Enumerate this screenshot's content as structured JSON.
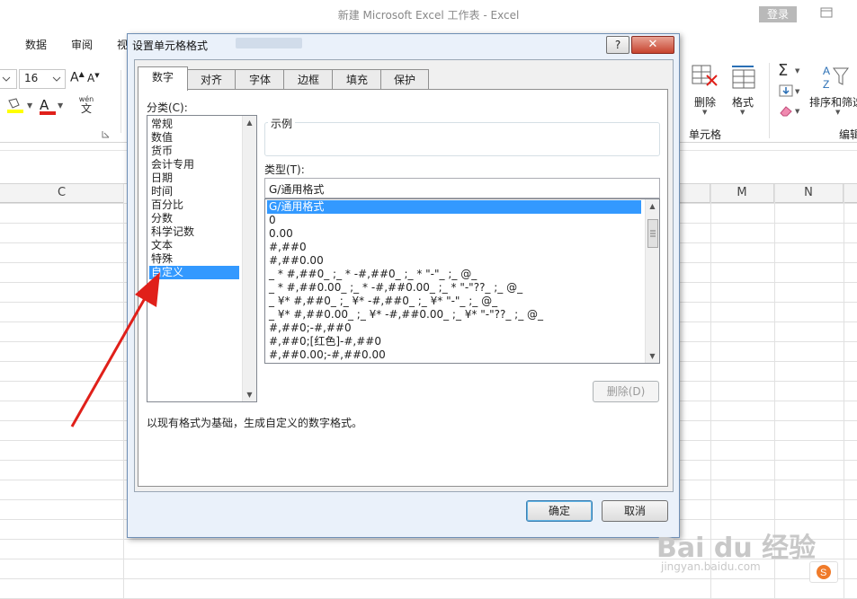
{
  "window": {
    "title": "新建 Microsoft Excel 工作表 - Excel",
    "login_label": "登录"
  },
  "menu": {
    "items": [
      "数据",
      "审阅",
      "视"
    ]
  },
  "ribbon": {
    "font_size": "16",
    "grow_font": "A",
    "shrink_font": "A",
    "font_color_letter": "A",
    "phonetic_label": "wén",
    "phonetic_char": "文",
    "cells_group": {
      "delete_label": "删除",
      "format_label": "格式",
      "group_label": "单元格"
    },
    "edit_group": {
      "sort_filter_label": "排序和筛选",
      "group_label": "编辑"
    }
  },
  "sheet": {
    "columns": [
      "C",
      "M",
      "N"
    ]
  },
  "dialog": {
    "title": "设置单元格格式",
    "help_label": "?",
    "close_label": "✕",
    "tabs": [
      "数字",
      "对齐",
      "字体",
      "边框",
      "填充",
      "保护"
    ],
    "active_tab": "数字",
    "category_label": "分类(C):",
    "categories": [
      "常规",
      "数值",
      "货币",
      "会计专用",
      "日期",
      "时间",
      "百分比",
      "分数",
      "科学记数",
      "文本",
      "特殊",
      "自定义"
    ],
    "selected_category": "自定义",
    "sample_label": "示例",
    "type_label": "类型(T):",
    "type_value": "G/通用格式",
    "formats": [
      "G/通用格式",
      "0",
      "0.00",
      "#,##0",
      "#,##0.00",
      "_ * #,##0_ ;_ * -#,##0_ ;_ * \"-\"_ ;_ @_",
      "_ * #,##0.00_ ;_ * -#,##0.00_ ;_ * \"-\"??_ ;_ @_",
      "_ ¥* #,##0_ ;_ ¥* -#,##0_ ;_ ¥* \"-\"_ ;_ @_",
      "_ ¥* #,##0.00_ ;_ ¥* -#,##0.00_ ;_ ¥* \"-\"??_ ;_ @_",
      "#,##0;-#,##0",
      "#,##0;[红色]-#,##0",
      "#,##0.00;-#,##0.00"
    ],
    "selected_format": "G/通用格式",
    "delete_button": "删除(D)",
    "description": "以现有格式为基础，生成自定义的数字格式。",
    "ok_button": "确定",
    "cancel_button": "取消"
  },
  "watermark": {
    "brand": "Bai du 经验",
    "url": "jingyan.baidu.com"
  },
  "colors": {
    "selection": "#3399ff",
    "arrow": "#e0201a",
    "dialog_frame": "#eaf1fa"
  }
}
